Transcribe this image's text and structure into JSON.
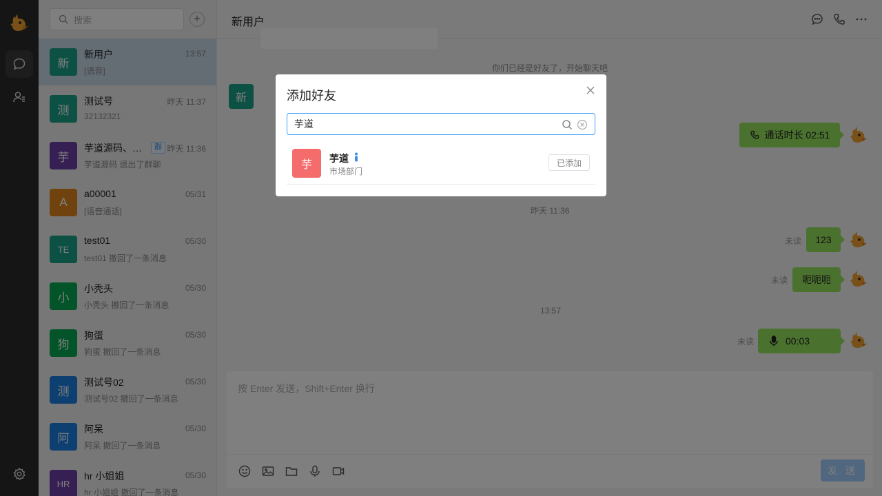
{
  "sidebar": {
    "nav": [
      {
        "name": "chat-nav",
        "icon": "message-bubble-icon",
        "active": true
      },
      {
        "name": "contacts-nav",
        "icon": "add-user-icon",
        "active": false
      }
    ],
    "settings_icon": "gear-icon"
  },
  "conversation_list": {
    "search_placeholder": "搜索",
    "items": [
      {
        "avatar_text": "新",
        "avatar_color": "#1aa089",
        "name": "新用户",
        "time": "13:57",
        "preview": "[语音]",
        "active": true
      },
      {
        "avatar_text": "测",
        "avatar_color": "#1aa089",
        "name": "测试号",
        "time": "昨天 11:37",
        "preview": "32132321"
      },
      {
        "avatar_text": "芋",
        "avatar_color": "#6b3fa6",
        "name": "芋道源码、新用户",
        "tag": "群",
        "time": "昨天 11:36",
        "preview": "芋道源码 退出了群聊"
      },
      {
        "avatar_text": "A",
        "avatar_color": "#e0861d",
        "name": "a00001",
        "time": "05/31",
        "preview": "[语音通话]"
      },
      {
        "avatar_text": "TE",
        "avatar_color": "#1aa089",
        "name": "test01",
        "time": "05/30",
        "preview": "test01 撤回了一条消息"
      },
      {
        "avatar_text": "小",
        "avatar_color": "#07a951",
        "name": "小秃头",
        "time": "05/30",
        "preview": "小秃头 撤回了一条消息"
      },
      {
        "avatar_text": "狗",
        "avatar_color": "#07a951",
        "name": "狗蛋",
        "time": "05/30",
        "preview": "狗蛋 撤回了一条消息"
      },
      {
        "avatar_text": "测",
        "avatar_color": "#1a7fe0",
        "name": "测试号02",
        "time": "05/30",
        "preview": "测试号02 撤回了一条消息"
      },
      {
        "avatar_text": "阿",
        "avatar_color": "#1a7fe0",
        "name": "阿呆",
        "time": "05/30",
        "preview": "阿呆 撤回了一条消息"
      },
      {
        "avatar_text": "HR",
        "avatar_color": "#6b3fa6",
        "name": "hr 小姐姐",
        "time": "05/30",
        "preview": "hr 小姐姐 撤回了一条消息"
      }
    ]
  },
  "chat": {
    "title": "新用户",
    "header_icons": [
      "chat-icon",
      "phone-icon",
      "more-icon"
    ],
    "peer_avatar_text": "新",
    "system_message": "你们已经是好友了，开始聊天吧",
    "call_duration": "通话时长 02:51",
    "timestamps": [
      "昨天 11:36",
      "13:57"
    ],
    "unread_label": "未读",
    "messages": [
      {
        "text": "123"
      },
      {
        "text": "呃呃呃"
      },
      {
        "text": "00:03",
        "type": "voice"
      }
    ],
    "composer_placeholder": "按 Enter 发送，Shift+Enter 换行",
    "toolbar": [
      "emoji-icon",
      "image-icon",
      "folder-icon",
      "microphone-icon",
      "video-icon"
    ],
    "send_label": "发 送"
  },
  "dialog": {
    "title": "添加好友",
    "search_value": "芋道",
    "result": {
      "avatar_text": "芋",
      "avatar_color": "#f56c6c",
      "name": "芋道",
      "department": "市场部门",
      "button_label": "已添加"
    }
  },
  "colors": {
    "accent": "#409eff",
    "bubble": "#95e25d",
    "rail": "#2b2b2b"
  }
}
